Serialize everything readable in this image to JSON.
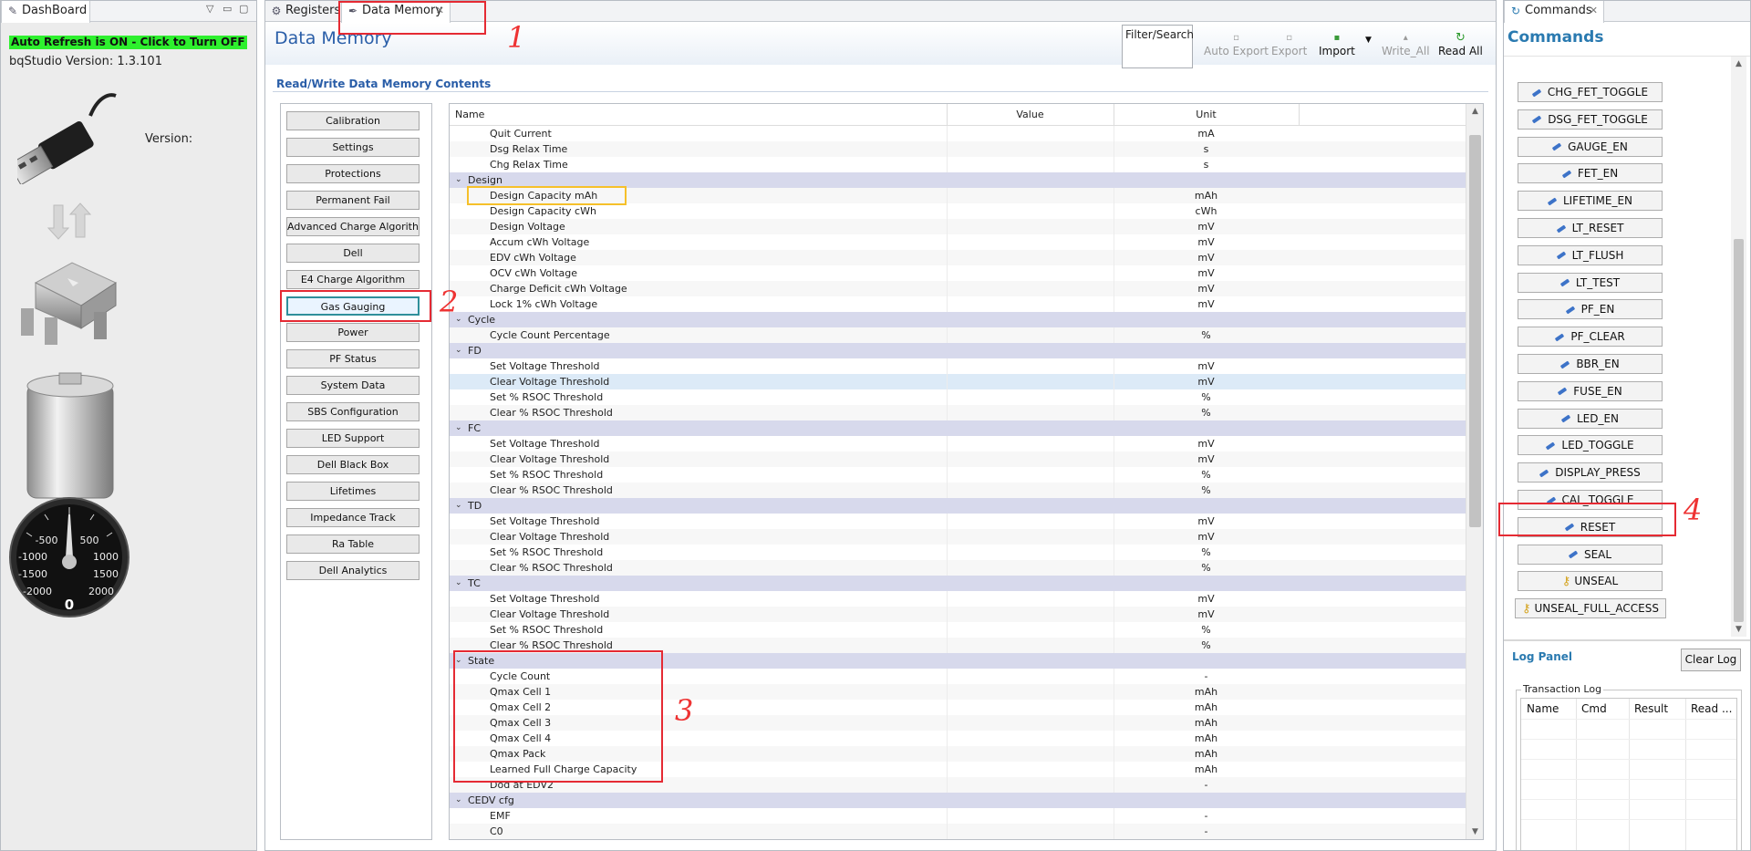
{
  "dashboard": {
    "tab_label": "DashBoard",
    "auto_refresh": "Auto Refresh is ON - Click to Turn OFF",
    "bqstudio_version": "bqStudio Version:  1.3.101",
    "version_label": "Version:",
    "gauge": {
      "ticks": [
        "-500",
        "500",
        "-1000",
        "1000",
        "-1500",
        "1500",
        "-2000",
        "2000"
      ],
      "value": "0"
    }
  },
  "editor_tabs": [
    {
      "label": "Registers"
    },
    {
      "label": "Data Memory"
    }
  ],
  "data_memory": {
    "title": "Data Memory",
    "filter_placeholder": "Filter/Search",
    "toolbar": {
      "auto_export": "Auto Export",
      "export": "Export",
      "import": "Import",
      "write_all": "Write_All",
      "read_all": "Read All"
    },
    "section_title": "Read/Write Data Memory Contents",
    "categories": [
      "Calibration",
      "Settings",
      "Protections",
      "Permanent Fail",
      "Advanced Charge Algorithm",
      "Dell",
      "E4 Charge Algorithm",
      "Gas Gauging",
      "Power",
      "PF Status",
      "System Data",
      "SBS Configuration",
      "LED Support",
      "Dell Black Box",
      "Lifetimes",
      "Impedance Track",
      "Ra Table",
      "Dell Analytics"
    ],
    "selected_category": "Gas Gauging",
    "columns": {
      "name": "Name",
      "value": "Value",
      "unit": "Unit"
    },
    "rows": [
      {
        "type": "item",
        "name": "Quit Current",
        "unit": "mA"
      },
      {
        "type": "item",
        "name": "Dsg Relax Time",
        "unit": "s"
      },
      {
        "type": "item",
        "name": "Chg Relax Time",
        "unit": "s"
      },
      {
        "type": "group",
        "name": "Design"
      },
      {
        "type": "item",
        "name": "Design Capacity mAh",
        "unit": "mAh"
      },
      {
        "type": "item",
        "name": "Design Capacity cWh",
        "unit": "cWh"
      },
      {
        "type": "item",
        "name": "Design Voltage",
        "unit": "mV"
      },
      {
        "type": "item",
        "name": "Accum cWh Voltage",
        "unit": "mV"
      },
      {
        "type": "item",
        "name": "EDV cWh Voltage",
        "unit": "mV"
      },
      {
        "type": "item",
        "name": "OCV cWh Voltage",
        "unit": "mV"
      },
      {
        "type": "item",
        "name": "Charge Deficit cWh Voltage",
        "unit": "mV"
      },
      {
        "type": "item",
        "name": "Lock 1% cWh Voltage",
        "unit": "mV"
      },
      {
        "type": "group",
        "name": "Cycle"
      },
      {
        "type": "item",
        "name": "Cycle Count Percentage",
        "unit": "%"
      },
      {
        "type": "group",
        "name": "FD"
      },
      {
        "type": "item",
        "name": "Set Voltage Threshold",
        "unit": "mV"
      },
      {
        "type": "item",
        "name": "Clear Voltage Threshold",
        "unit": "mV",
        "highlight": true
      },
      {
        "type": "item",
        "name": "Set % RSOC Threshold",
        "unit": "%"
      },
      {
        "type": "item",
        "name": "Clear % RSOC Threshold",
        "unit": "%"
      },
      {
        "type": "group",
        "name": "FC"
      },
      {
        "type": "item",
        "name": "Set Voltage Threshold",
        "unit": "mV"
      },
      {
        "type": "item",
        "name": "Clear Voltage Threshold",
        "unit": "mV"
      },
      {
        "type": "item",
        "name": "Set % RSOC Threshold",
        "unit": "%"
      },
      {
        "type": "item",
        "name": "Clear % RSOC Threshold",
        "unit": "%"
      },
      {
        "type": "group",
        "name": "TD"
      },
      {
        "type": "item",
        "name": "Set Voltage Threshold",
        "unit": "mV"
      },
      {
        "type": "item",
        "name": "Clear Voltage Threshold",
        "unit": "mV"
      },
      {
        "type": "item",
        "name": "Set % RSOC Threshold",
        "unit": "%"
      },
      {
        "type": "item",
        "name": "Clear % RSOC Threshold",
        "unit": "%"
      },
      {
        "type": "group",
        "name": "TC"
      },
      {
        "type": "item",
        "name": "Set Voltage Threshold",
        "unit": "mV"
      },
      {
        "type": "item",
        "name": "Clear Voltage Threshold",
        "unit": "mV"
      },
      {
        "type": "item",
        "name": "Set % RSOC Threshold",
        "unit": "%"
      },
      {
        "type": "item",
        "name": "Clear % RSOC Threshold",
        "unit": "%"
      },
      {
        "type": "group",
        "name": "State"
      },
      {
        "type": "item",
        "name": "Cycle Count",
        "unit": "-"
      },
      {
        "type": "item",
        "name": "Qmax Cell 1",
        "unit": "mAh"
      },
      {
        "type": "item",
        "name": "Qmax Cell 2",
        "unit": "mAh"
      },
      {
        "type": "item",
        "name": "Qmax Cell 3",
        "unit": "mAh"
      },
      {
        "type": "item",
        "name": "Qmax Cell 4",
        "unit": "mAh"
      },
      {
        "type": "item",
        "name": "Qmax Pack",
        "unit": "mAh"
      },
      {
        "type": "item",
        "name": "Learned Full Charge Capacity",
        "unit": "mAh"
      },
      {
        "type": "item",
        "name": "Dod at EDV2",
        "unit": "-"
      },
      {
        "type": "group",
        "name": "CEDV cfg"
      },
      {
        "type": "item",
        "name": "EMF",
        "unit": "-"
      },
      {
        "type": "item",
        "name": "C0",
        "unit": "-"
      }
    ]
  },
  "commands": {
    "tab_label": "Commands",
    "title": "Commands",
    "buttons": [
      {
        "label": "CHG_FET_TOGGLE",
        "icon": "pencil-icon"
      },
      {
        "label": "DSG_FET_TOGGLE",
        "icon": "pencil-icon"
      },
      {
        "label": "GAUGE_EN",
        "icon": "pencil-icon"
      },
      {
        "label": "FET_EN",
        "icon": "pencil-icon"
      },
      {
        "label": "LIFETIME_EN",
        "icon": "pencil-icon"
      },
      {
        "label": "LT_RESET",
        "icon": "pencil-icon"
      },
      {
        "label": "LT_FLUSH",
        "icon": "pencil-icon"
      },
      {
        "label": "LT_TEST",
        "icon": "pencil-icon"
      },
      {
        "label": "PF_EN",
        "icon": "pencil-icon"
      },
      {
        "label": "PF_CLEAR",
        "icon": "pencil-icon"
      },
      {
        "label": "BBR_EN",
        "icon": "pencil-icon"
      },
      {
        "label": "FUSE_EN",
        "icon": "pencil-icon"
      },
      {
        "label": "LED_EN",
        "icon": "pencil-icon"
      },
      {
        "label": "LED_TOGGLE",
        "icon": "pencil-icon"
      },
      {
        "label": "DISPLAY_PRESS",
        "icon": "pencil-icon"
      },
      {
        "label": "CAL_TOGGLE",
        "icon": "pencil-icon"
      },
      {
        "label": "RESET",
        "icon": "pencil-icon"
      },
      {
        "label": "SEAL",
        "icon": "pencil-icon"
      },
      {
        "label": "UNSEAL",
        "icon": "key-icon"
      },
      {
        "label": "UNSEAL_FULL_ACCESS",
        "icon": "key-icon"
      }
    ],
    "log_panel": "Log Panel",
    "clear_log": "Clear Log",
    "transaction_log": "Transaction Log",
    "log_columns": [
      "Name",
      "Cmd",
      "Result",
      "Read ..."
    ]
  },
  "annotations": [
    "1",
    "2",
    "3",
    "4"
  ],
  "colors": {
    "accent_blue": "#2a5ea8",
    "refresh_green": "#2ef02e",
    "annotation_red": "#e52a33",
    "annotation_yellow": "#f6c02a",
    "group_row": "#d7d9ec"
  }
}
